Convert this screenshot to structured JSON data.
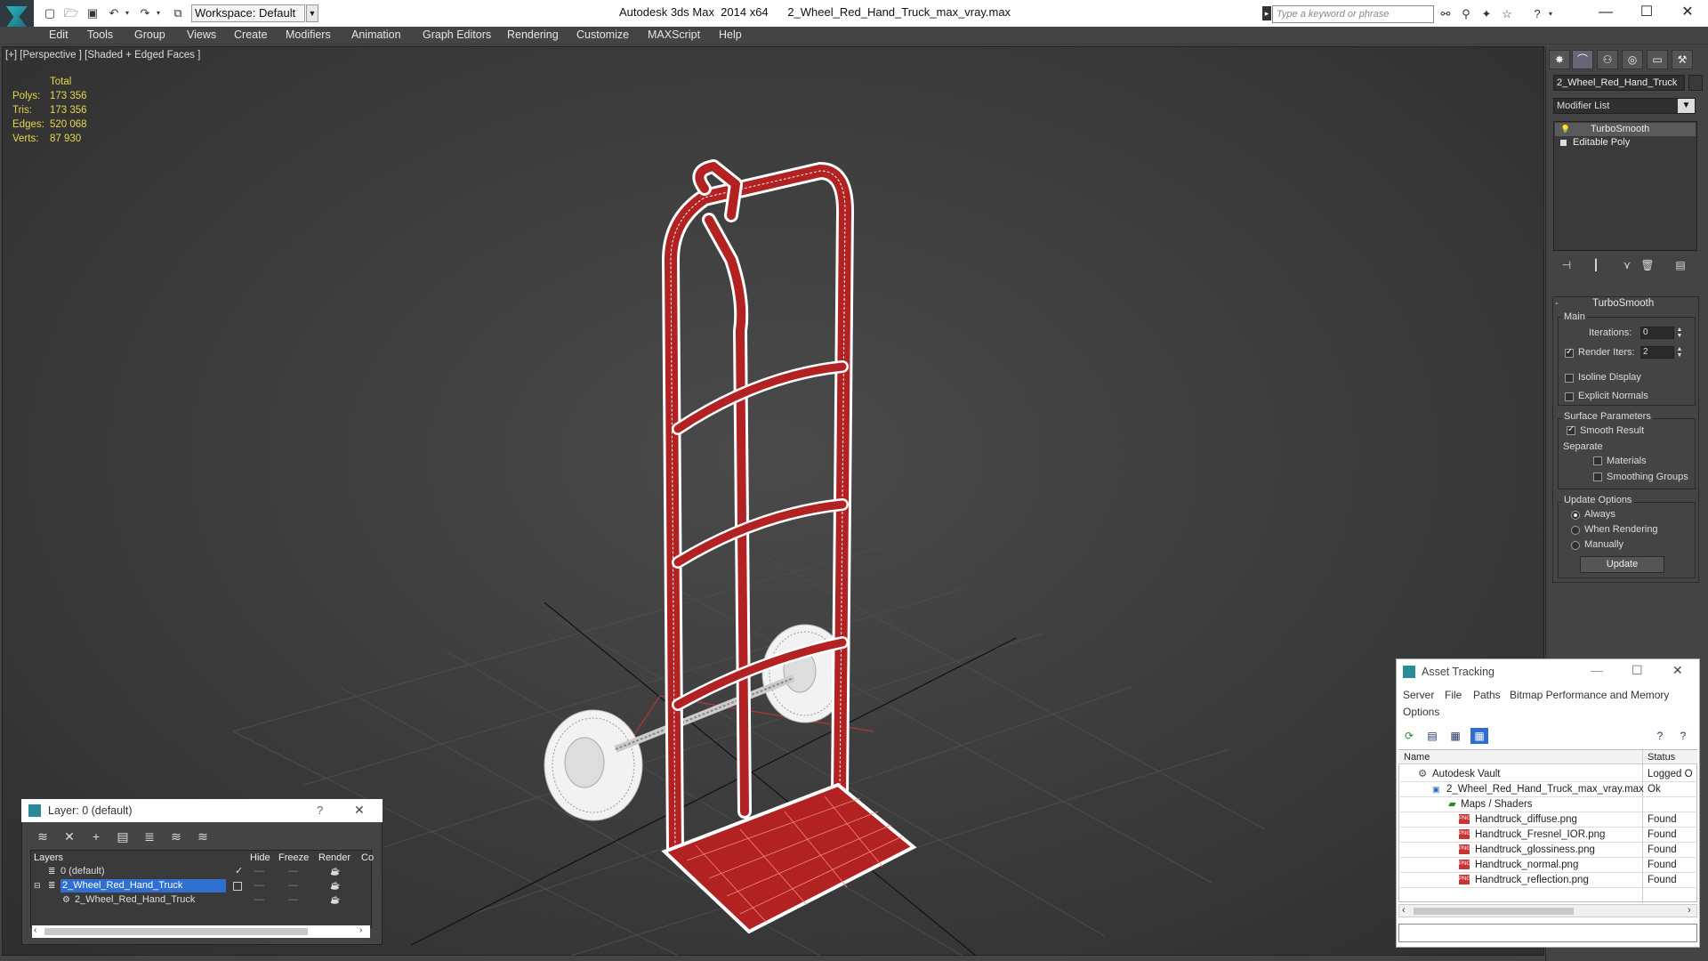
{
  "titlebar": {
    "workspace_label": "Workspace: Default",
    "window_title": "Autodesk 3ds Max  2014 x64      2_Wheel_Red_Hand_Truck_max_vray.max",
    "search_placeholder": "Type a keyword or phrase",
    "minimize": "—",
    "maximize": "☐",
    "close": "✕"
  },
  "menu": [
    "Edit",
    "Tools",
    "Group",
    "Views",
    "Create",
    "Modifiers",
    "Animation",
    "Graph Editors",
    "Rendering",
    "Customize",
    "MAXScript",
    "Help"
  ],
  "viewport": {
    "label": "[+] [Perspective ] [Shaded + Edged Faces ]",
    "stats": {
      "header": "Total",
      "rows": [
        {
          "label": "Polys:",
          "value": "173 356"
        },
        {
          "label": "Tris:",
          "value": "173 356"
        },
        {
          "label": "Edges:",
          "value": "520 068"
        },
        {
          "label": "Verts:",
          "value": "87 930"
        }
      ]
    },
    "model_color": "#b22222",
    "wire_color": "#ffffff"
  },
  "command_panel": {
    "object_name": "2_Wheel_Red_Hand_Truck",
    "modifier_list": "Modifier List",
    "stack": [
      "TurboSmooth",
      "Editable Poly"
    ],
    "turbosmooth": {
      "title": "TurboSmooth",
      "main_label": "Main",
      "iterations_label": "Iterations:",
      "iterations_value": "0",
      "render_iters_label": "Render Iters:",
      "render_iters_value": "2",
      "isoline_display": "Isoline Display",
      "explicit_normals": "Explicit Normals",
      "surface_params_label": "Surface Parameters",
      "smooth_result": "Smooth Result",
      "separate_label": "Separate",
      "materials": "Materials",
      "smoothing_groups": "Smoothing Groups",
      "update_options_label": "Update Options",
      "always": "Always",
      "when_rendering": "When Rendering",
      "manually": "Manually",
      "update_button": "Update"
    }
  },
  "layer_dialog": {
    "title": "Layer: 0 (default)",
    "help": "?",
    "close": "✕",
    "columns": [
      "Layers",
      "Hide",
      "Freeze",
      "Render",
      "Co"
    ],
    "rows": [
      {
        "name": "0 (default)",
        "level": 0
      },
      {
        "name": "2_Wheel_Red_Hand_Truck",
        "level": 0
      },
      {
        "name": "2_Wheel_Red_Hand_Truck",
        "level": 1
      }
    ]
  },
  "asset_tracking": {
    "title": "Asset Tracking",
    "menu": [
      "Server",
      "File",
      "Paths",
      "Bitmap Performance and Memory",
      "Options"
    ],
    "columns": [
      "Name",
      "Status"
    ],
    "rows": [
      {
        "name": "Autodesk Vault",
        "status": "Logged O"
      },
      {
        "name": "2_Wheel_Red_Hand_Truck_max_vray.max",
        "status": "Ok"
      },
      {
        "name": "Maps / Shaders",
        "status": ""
      },
      {
        "name": "Handtruck_diffuse.png",
        "status": "Found"
      },
      {
        "name": "Handtruck_Fresnel_IOR.png",
        "status": "Found"
      },
      {
        "name": "Handtruck_glossiness.png",
        "status": "Found"
      },
      {
        "name": "Handtruck_normal.png",
        "status": "Found"
      },
      {
        "name": "Handtruck_reflection.png",
        "status": "Found"
      }
    ]
  }
}
